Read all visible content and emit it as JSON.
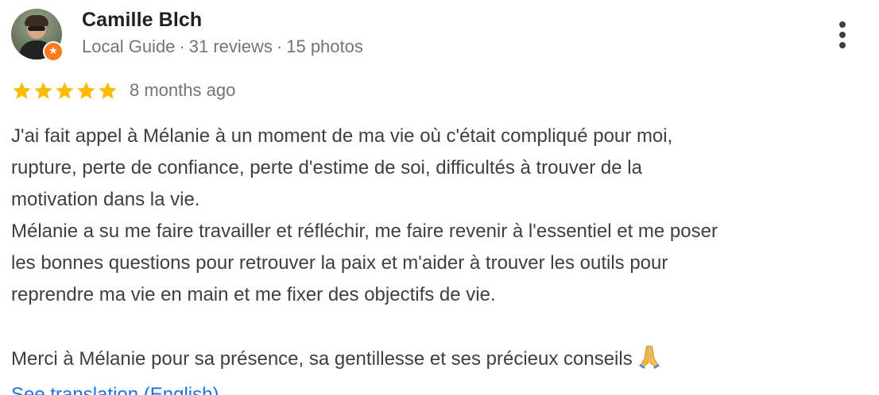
{
  "author": {
    "name": "Camille Blch",
    "meta_parts": [
      "Local Guide",
      "31 reviews",
      "15 photos"
    ],
    "meta_separator": "·",
    "badge_icon": "local-guide-star-icon",
    "badge_glyph": "★",
    "badge_color": "#ff7a1a"
  },
  "menu": {
    "icon": "more-vert-icon"
  },
  "rating": {
    "stars": 5,
    "max_stars": 5,
    "star_color": "#fbbc04",
    "date": "8 months ago"
  },
  "review": {
    "lines": [
      "J'ai fait appel à Mélanie à un moment de ma vie où c'était compliqué pour moi,",
      "rupture, perte de confiance, perte d'estime de soi, difficultés à trouver de la",
      "motivation dans la vie.",
      "Mélanie a su me faire travailler et réfléchir, me faire revenir à l'essentiel et me poser",
      "les bonnes questions pour retrouver la paix et m'aider à trouver les outils pour",
      "reprendre ma vie en main et me fixer des objectifs de vie.",
      "",
      "Merci à Mélanie pour sa présence, sa gentillesse et ses précieux conseils"
    ],
    "closing_emoji": "folded-hands-emoji"
  },
  "translate": {
    "label": "See translation (English)"
  },
  "colors": {
    "text": "#3c4043",
    "name": "#202124",
    "secondary": "#70757a",
    "link": "#1a73e8"
  }
}
